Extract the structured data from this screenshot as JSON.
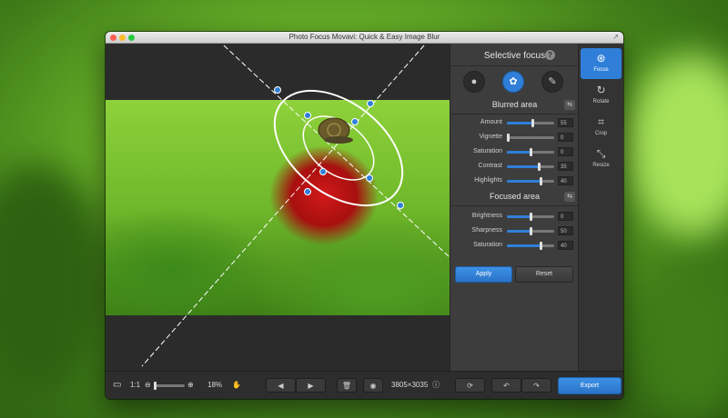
{
  "window": {
    "title": "Photo Focus Movavi: Quick & Easy Image Blur",
    "expand_icon": "↗"
  },
  "panel": {
    "title": "Selective focus",
    "help": "?",
    "tools": [
      {
        "name": "person-tool",
        "glyph": "●",
        "active": false
      },
      {
        "name": "tulip-tool",
        "glyph": "✿",
        "active": true
      },
      {
        "name": "brush-tool",
        "glyph": "✎",
        "active": false
      }
    ],
    "blurred_area": {
      "title": "Blurred area",
      "sliders": [
        {
          "label": "Amount",
          "value": "55"
        },
        {
          "label": "Vignette",
          "value": "0"
        },
        {
          "label": "Saturation",
          "value": "0"
        },
        {
          "label": "Contrast",
          "value": "35"
        },
        {
          "label": "Highlights",
          "value": "40"
        }
      ]
    },
    "focused_area": {
      "title": "Focused area",
      "sliders": [
        {
          "label": "Brightness",
          "value": "0"
        },
        {
          "label": "Sharpness",
          "value": "50"
        },
        {
          "label": "Saturation",
          "value": "40"
        }
      ]
    },
    "apply_label": "Apply",
    "reset_label": "Reset",
    "reset_icon": "⇆"
  },
  "sidebar": {
    "items": [
      {
        "label": "Focus",
        "icon": "⊛",
        "active": true
      },
      {
        "label": "Rotate",
        "icon": "↻",
        "active": false
      },
      {
        "label": "Crop",
        "icon": "⌗",
        "active": false
      },
      {
        "label": "Resize",
        "icon": "⤡",
        "active": false
      }
    ]
  },
  "bottom": {
    "fit_icon": "▭",
    "one_to_one": "1:1",
    "zoom_out_icon": "⊖",
    "zoom_in_icon": "⊕",
    "zoom": "18%",
    "hand_icon": "✋",
    "prev_icon": "◀",
    "next_icon": "▶",
    "delete_icon": "🗑",
    "eye_icon": "◉",
    "dimensions": "3805×3035",
    "info_icon": "ⓘ",
    "compare_icon": "⟳",
    "undo_icon": "↶",
    "redo_icon": "↷",
    "export_label": "Export"
  },
  "colors": {
    "accent": "#2f7fd9",
    "red_button": "#ff5f57",
    "yellow_button": "#febc2e",
    "green_button": "#28c840"
  }
}
